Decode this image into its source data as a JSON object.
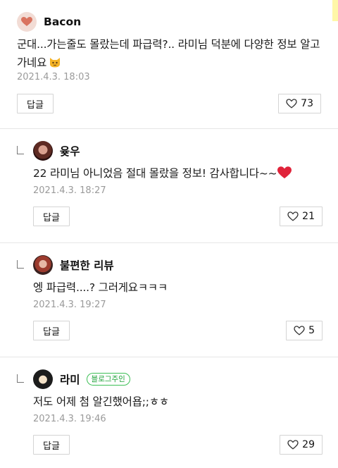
{
  "comments": [
    {
      "nickname": "Bacon",
      "text": "군대...가는줄도 몰랐는데 파급력?.. 라미님 덕분에 다양한 정보 알고가네요",
      "emoji": "cat-face-emoji",
      "date": "2021.4.3. 18:03",
      "reply_label": "답글",
      "likes": "73",
      "avatar": "heart-avatar"
    }
  ],
  "replies": [
    {
      "nickname": "윶우",
      "text": "22 라미님 아니었음 절대 몰랐을 정보! 감사합니다~~",
      "emoji": "red-heart-emoji",
      "date": "2021.4.3. 18:27",
      "reply_label": "답글",
      "likes": "21"
    },
    {
      "nickname": "불편한 리뷰",
      "text": "엥 파급력....? 그러게요ㅋㅋㅋ",
      "date": "2021.4.3. 19:27",
      "reply_label": "답글",
      "likes": "5"
    },
    {
      "nickname": "라미",
      "badge": "블로그주인",
      "text": "저도 어제 첨 알긴했어욥;;ㅎㅎ",
      "date": "2021.4.3. 19:46",
      "reply_label": "답글",
      "likes": "29"
    }
  ],
  "colors": {
    "badge_green": "#1fa33a",
    "date_gray": "#9a9a9a",
    "divider": "#e6e6e6"
  }
}
